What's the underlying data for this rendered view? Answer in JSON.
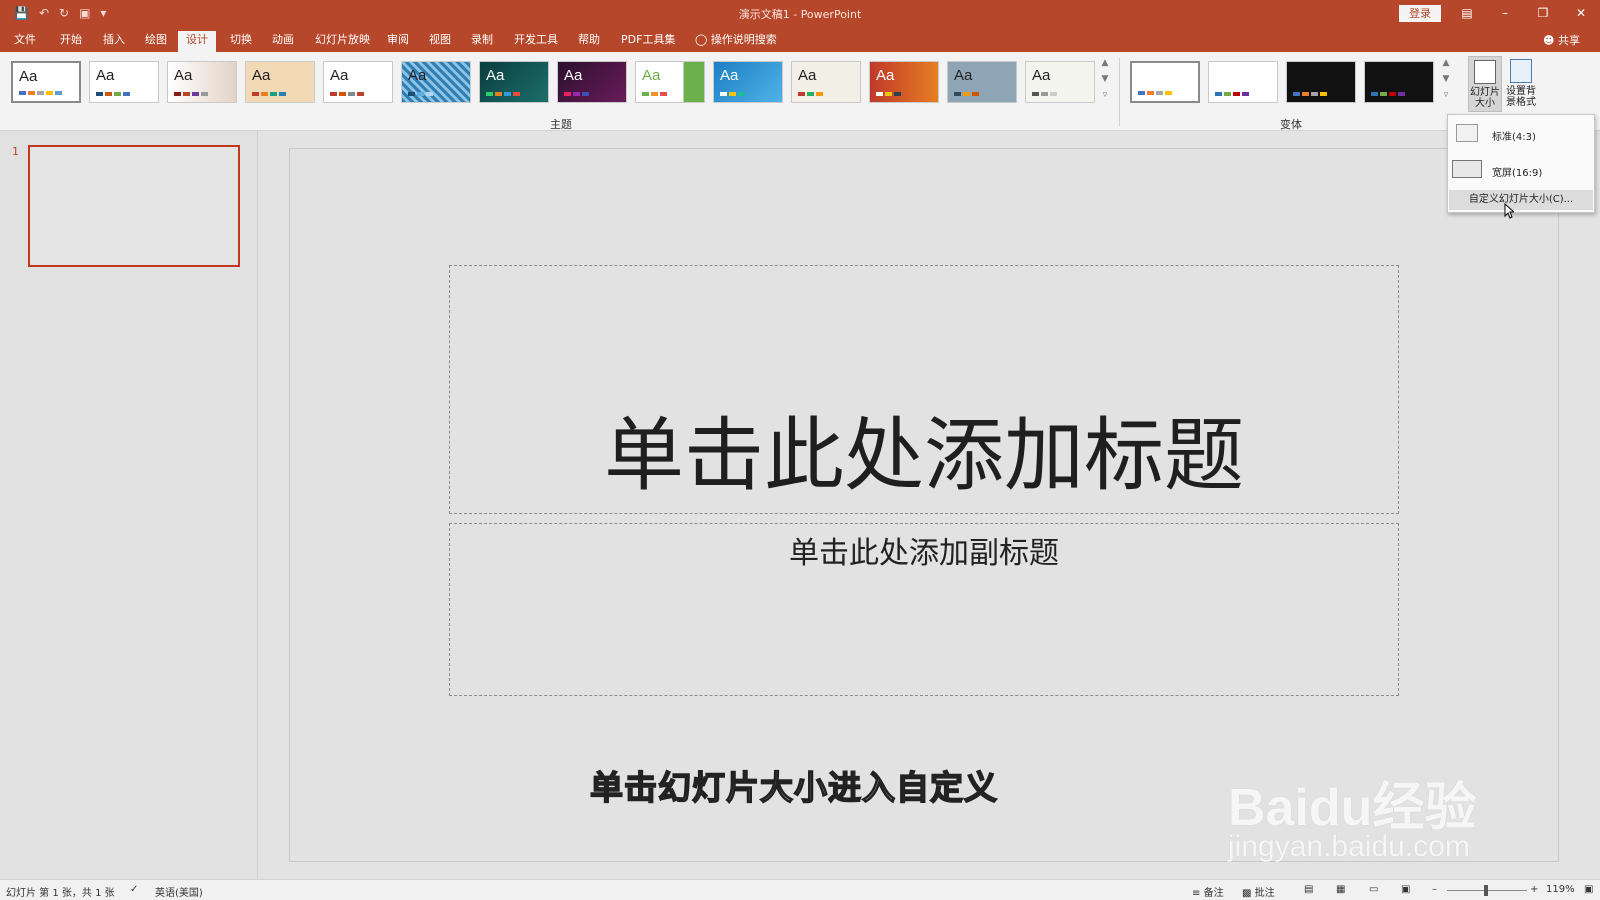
{
  "titlebar": {
    "title": "演示文稿1  -  PowerPoint",
    "login": "登录",
    "qat_icons": [
      "save-icon",
      "undo-icon",
      "redo-icon",
      "start-presentation-icon",
      "customize-qat-icon"
    ]
  },
  "tabs": [
    "文件",
    "开始",
    "插入",
    "绘图",
    "设计",
    "切换",
    "动画",
    "幻灯片放映",
    "审阅",
    "视图",
    "录制",
    "开发工具",
    "帮助",
    "PDF工具集"
  ],
  "active_tab": "设计",
  "tell_me": "操作说明搜索",
  "share": "共享",
  "ribbon": {
    "themes_label": "主题",
    "variants_label": "变体",
    "theme_aa": "Aa",
    "slide_size_label": "幻灯片大小",
    "format_bg_label": "设置背景格式"
  },
  "dropdown": {
    "standard": "标准(4:3)",
    "widescreen": "宽屏(16:9)",
    "custom": "自定义幻灯片大小(C)..."
  },
  "slide_pane": {
    "number": "1"
  },
  "slide": {
    "title_placeholder": "单击此处添加标题",
    "subtitle_placeholder": "单击此处添加副标题"
  },
  "caption": "单击幻灯片大小进入自定义",
  "watermark": {
    "logo": "Baidu经验",
    "url": "jingyan.baidu.com"
  },
  "statusbar": {
    "slide_info": "幻灯片 第 1 张，共 1 张",
    "language": "英语(美国)",
    "notes": "备注",
    "comments": "批注",
    "zoom": "119%"
  }
}
